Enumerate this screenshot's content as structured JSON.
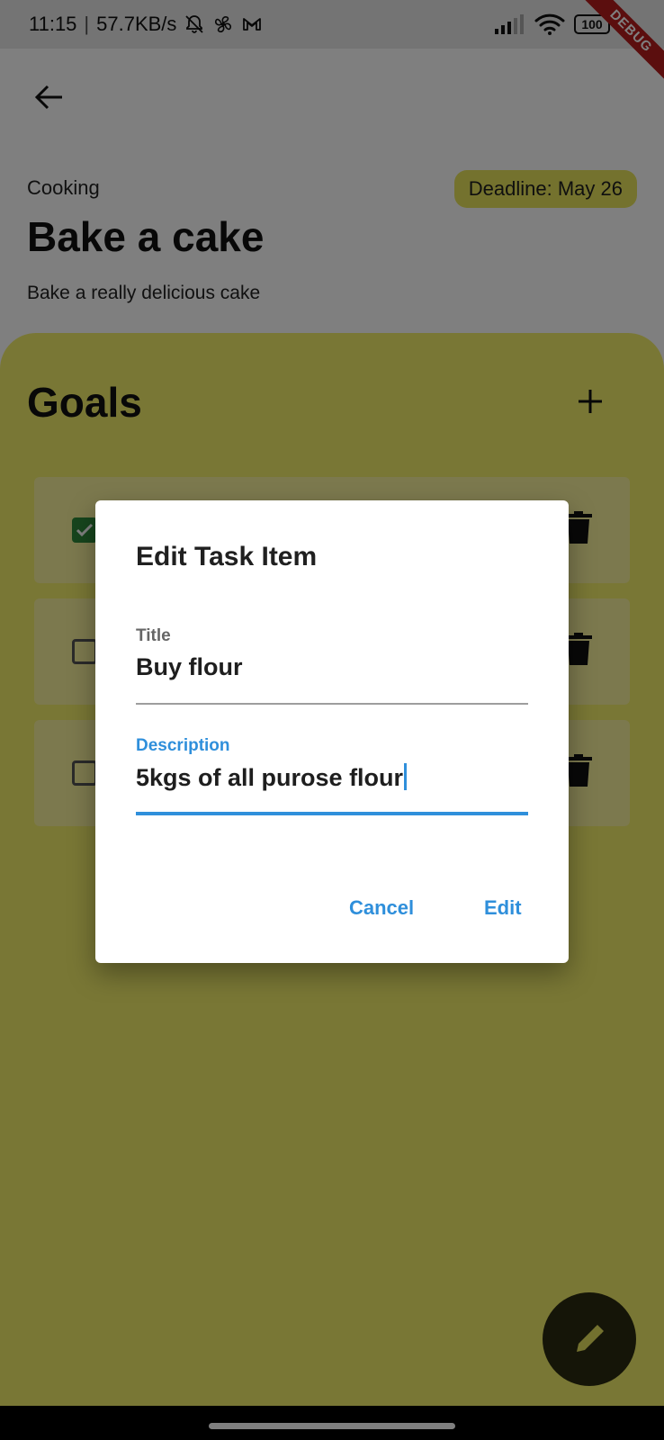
{
  "status_bar": {
    "time": "11:15",
    "speed": "57.7KB/s",
    "battery": "100",
    "debug_banner": "DEBUG"
  },
  "header": {
    "category": "Cooking",
    "deadline": "Deadline: May 26",
    "title": "Bake a cake",
    "description": "Bake a really delicious cake"
  },
  "goals": {
    "title": "Goals",
    "tasks": [
      {
        "checked": true
      },
      {
        "checked": false
      },
      {
        "checked": false
      }
    ]
  },
  "dialog": {
    "title": "Edit Task Item",
    "title_label": "Title",
    "title_value": "Buy flour",
    "description_label": "Description",
    "description_value": "5kgs of all purose flour",
    "cancel_label": "Cancel",
    "confirm_label": "Edit"
  },
  "colors": {
    "accent": "#2f8fdb",
    "panel": "#f2ee6a",
    "deadline_chip": "#e8e45c",
    "checkbox_checked": "#2e8b3a"
  },
  "icons": {
    "back": "arrow-left-icon",
    "add": "plus-icon",
    "delete": "trash-icon",
    "fab": "pencil-icon"
  }
}
